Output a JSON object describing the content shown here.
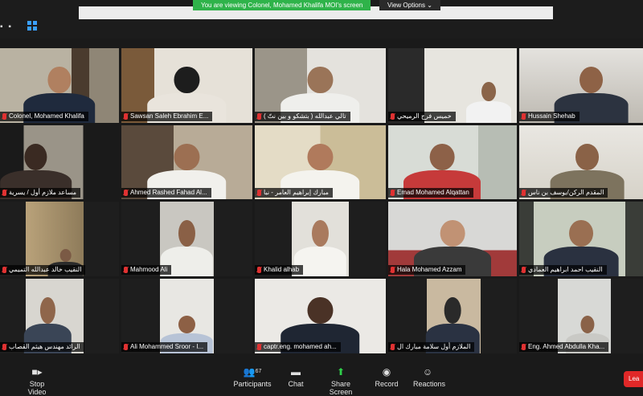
{
  "top_bar": {
    "share_banner": "You are viewing Colonel, Mohamed Khalifa MOI's screen",
    "view_options": "View Options ⌄"
  },
  "participants": [
    {
      "name": "Colonel, Mohamed Khalifa"
    },
    {
      "name": "Sawsan Saleh Ebrahim E..."
    },
    {
      "name": "تالي عبدالله ( بتشكو و بين نتّ )"
    },
    {
      "name": "خميس فرج الرميحي"
    },
    {
      "name": "Hussain Shehab"
    },
    {
      "name": "مساعد ملازم أول / يسرية"
    },
    {
      "name": "Ahmed Rashed Fahad Al..."
    },
    {
      "name": "مبارك إبراهيم العامر - نبا"
    },
    {
      "name": "Emad Mohamed Alqattan"
    },
    {
      "name": "المقدم الركن/يوسف بن ناس"
    },
    {
      "name": "النقيب خالد عبدالله التميمي"
    },
    {
      "name": "Mahmood Ali"
    },
    {
      "name": "Khalid alhab"
    },
    {
      "name": "Hala Mohamed Azzam"
    },
    {
      "name": "النقيب احمد ابراهيم العمادي"
    },
    {
      "name": "الرائد مهندس هيثم القصاب"
    },
    {
      "name": "Ali Mohammed Sroor - I..."
    },
    {
      "name": "captr.eng. mohamed ah..."
    },
    {
      "name": "الملازم أول سلامة مبارك ال"
    },
    {
      "name": "Eng. Ahmed Abdulla Kha..."
    }
  ],
  "toolbar": {
    "stop_video": "Stop Video",
    "participants": "Participants",
    "participants_count": "67",
    "chat": "Chat",
    "share_screen": "Share Screen",
    "record": "Record",
    "reactions": "Reactions",
    "leave": "Lea"
  }
}
